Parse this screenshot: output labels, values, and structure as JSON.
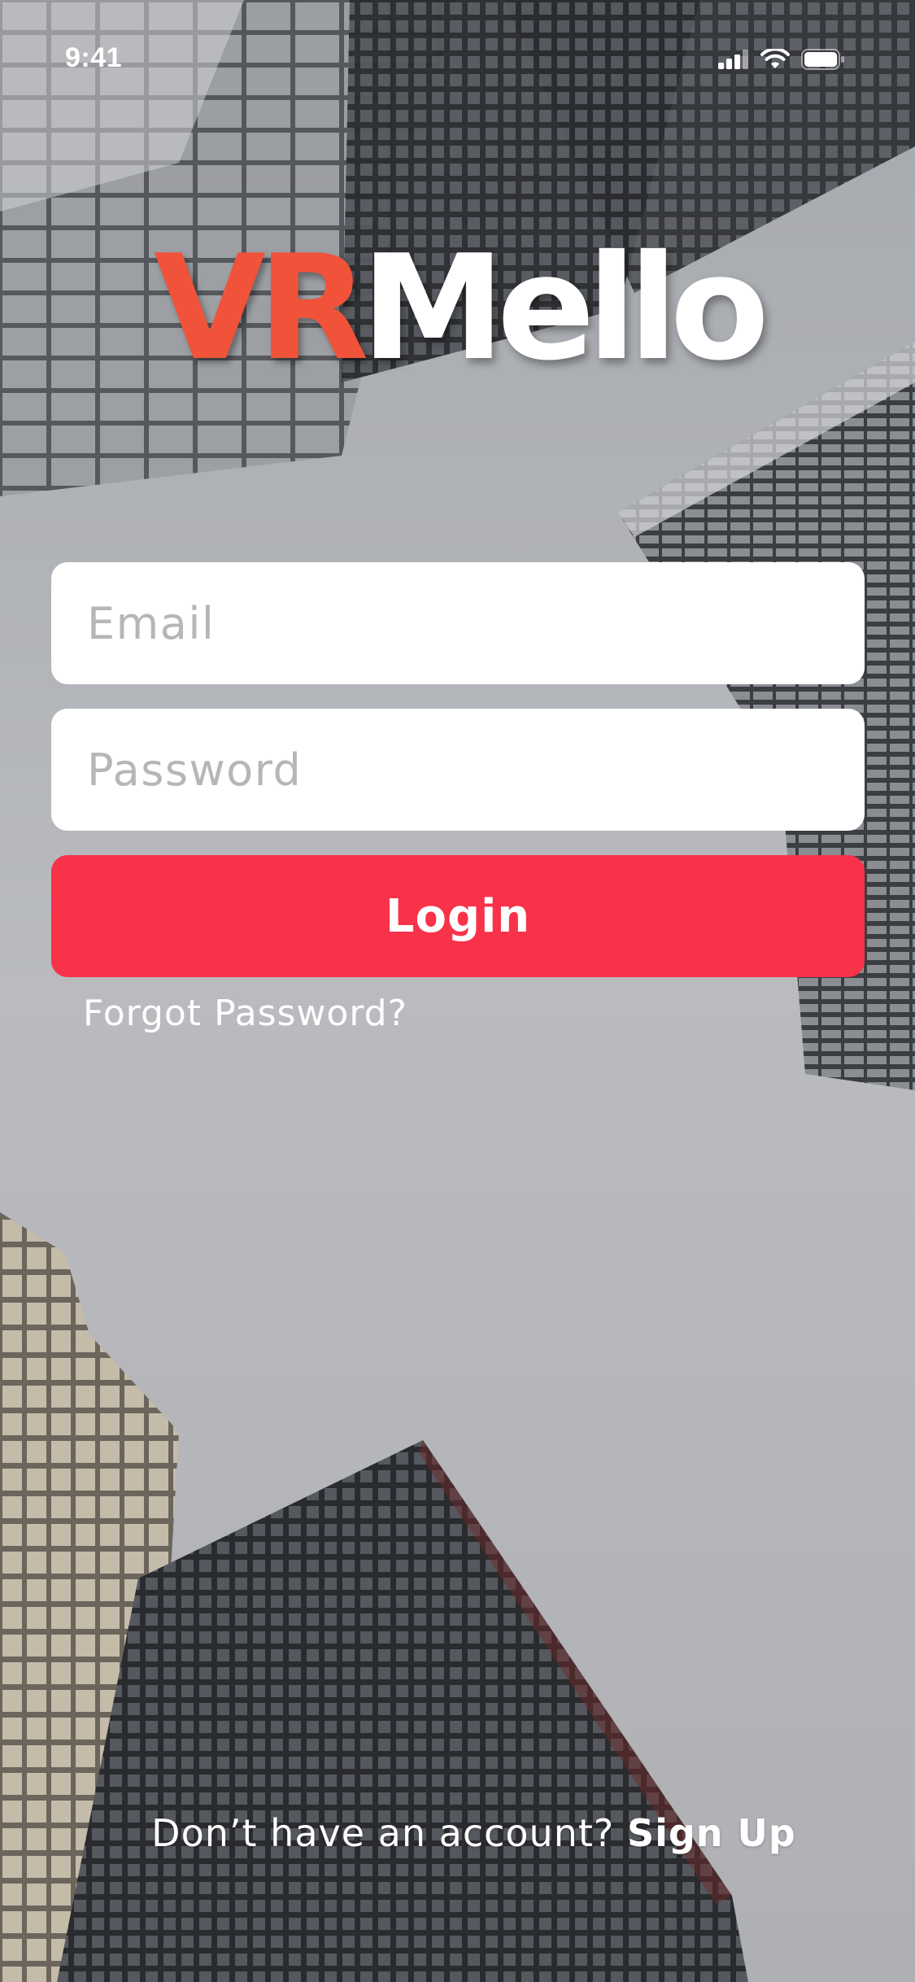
{
  "status_bar": {
    "time": "9:41",
    "icons": [
      "cellular-signal-icon",
      "wifi-icon",
      "battery-icon"
    ]
  },
  "logo": {
    "part1": "VR",
    "part2": "Mello",
    "colors": {
      "part1": "#f0533a",
      "part2": "#ffffff"
    }
  },
  "form": {
    "email": {
      "placeholder": "Email",
      "value": ""
    },
    "password": {
      "placeholder": "Password",
      "value": ""
    },
    "login_label": "Login",
    "forgot_password": "Forgot Password?"
  },
  "footer": {
    "prompt": "Don’t have an account?",
    "signup_label": "Sign Up"
  },
  "colors": {
    "primary": "#f83249",
    "field_background": "#ffffff",
    "placeholder": "#b6b6b6"
  }
}
